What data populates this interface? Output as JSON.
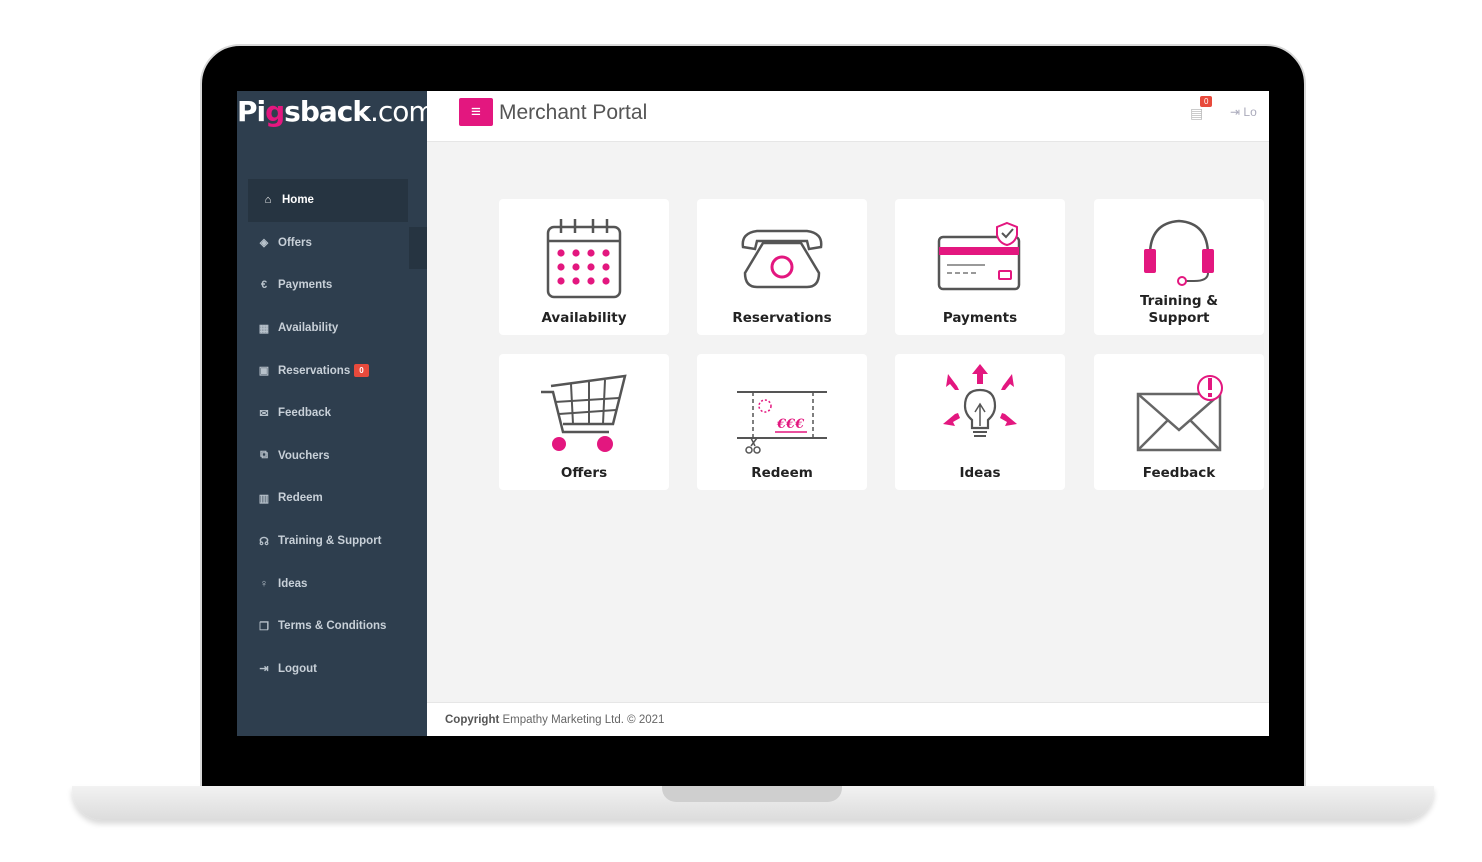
{
  "brand": {
    "logo_main": "Pi",
    "logo_g": "g",
    "logo_rest": "sback",
    "logo_dotcom": ".com"
  },
  "header": {
    "title": "Merchant Portal",
    "cart_count": "0",
    "logout_label": "Lo"
  },
  "sidebar": {
    "items": [
      {
        "label": "Home",
        "icon": "home-icon",
        "glyph": "⌂"
      },
      {
        "label": "Offers",
        "icon": "tags-icon",
        "glyph": "◈"
      },
      {
        "label": "Payments",
        "icon": "euro-icon",
        "glyph": "€"
      },
      {
        "label": "Availability",
        "icon": "calendar-icon",
        "glyph": "▦"
      },
      {
        "label": "Reservations",
        "icon": "calendar-plus-icon",
        "glyph": "▣",
        "badge": "0"
      },
      {
        "label": "Feedback",
        "icon": "envelope-icon",
        "glyph": "✉"
      },
      {
        "label": "Vouchers",
        "icon": "voucher-icon",
        "glyph": "⧉"
      },
      {
        "label": "Redeem",
        "icon": "barcode-icon",
        "glyph": "▥"
      },
      {
        "label": "Training & Support",
        "icon": "headphones-icon",
        "glyph": "☊"
      },
      {
        "label": "Ideas",
        "icon": "lightbulb-icon",
        "glyph": "♀"
      },
      {
        "label": "Terms & Conditions",
        "icon": "copy-icon",
        "glyph": "❐"
      },
      {
        "label": "Logout",
        "icon": "sign-out-icon",
        "glyph": "⇥"
      }
    ]
  },
  "tiles": [
    {
      "label": "Availability",
      "icon": "calendar-icon"
    },
    {
      "label": "Reservations",
      "icon": "telephone-icon"
    },
    {
      "label": "Payments",
      "icon": "credit-card-icon"
    },
    {
      "label": "Training & Support",
      "label_line1": "Training &",
      "label_line2": "Support",
      "icon": "headset-icon"
    },
    {
      "label": "Offers",
      "icon": "shopping-cart-icon"
    },
    {
      "label": "Redeem",
      "icon": "voucher-scissors-icon"
    },
    {
      "label": "Ideas",
      "icon": "lightbulb-arrows-icon"
    },
    {
      "label": "Feedback",
      "icon": "envelope-alert-icon"
    }
  ],
  "footer": {
    "copyright_bold": "Copyright",
    "copyright_rest": " Empathy Marketing Ltd. © 2021"
  },
  "colors": {
    "accent": "#e3177f",
    "sidebar": "#2e3e4e",
    "badge": "#e84a3c"
  }
}
